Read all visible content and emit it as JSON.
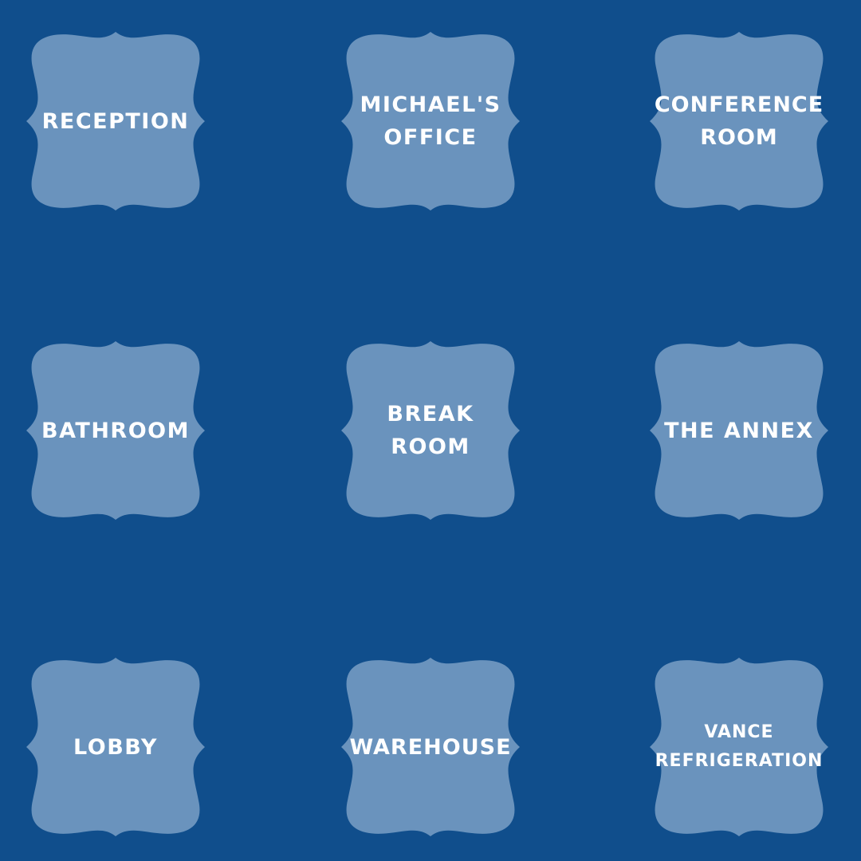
{
  "background_color": "#104e8c",
  "tile_color": "#6a93bd",
  "text_color": "#ffffff",
  "rooms": [
    {
      "line1": "RECEPTION",
      "line2": ""
    },
    {
      "line1": "MICHAEL'S",
      "line2": "OFFICE"
    },
    {
      "line1": "CONFERENCE",
      "line2": "ROOM"
    },
    {
      "line1": "BATHROOM",
      "line2": ""
    },
    {
      "line1": "BREAK",
      "line2": "ROOM"
    },
    {
      "line1": "THE ANNEX",
      "line2": ""
    },
    {
      "line1": "LOBBY",
      "line2": ""
    },
    {
      "line1": "WAREHOUSE",
      "line2": ""
    },
    {
      "line1": "VANCE",
      "line2": "REFRIGERATION"
    }
  ]
}
